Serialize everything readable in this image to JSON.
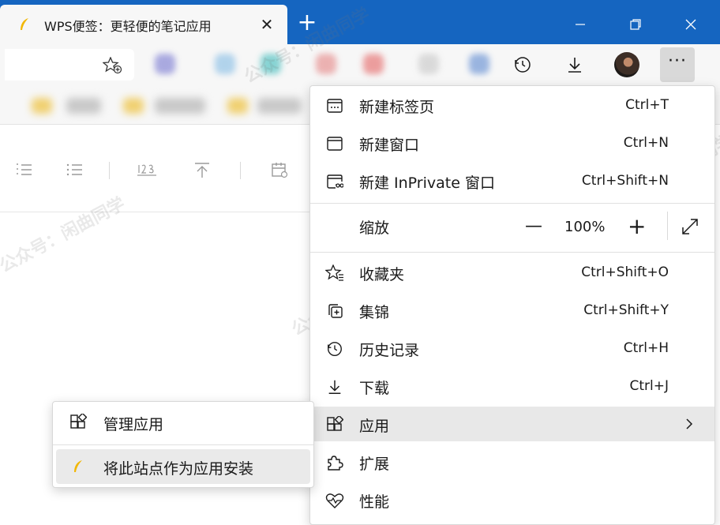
{
  "tab": {
    "title": "WPS便签：更轻便的笔记应用",
    "favicon": "feather-icon"
  },
  "window_controls": [
    "minimize-icon",
    "restore-icon",
    "close-icon"
  ],
  "toolbar": {
    "icons": [
      "favorites-add-icon",
      "history-icon",
      "download-icon",
      "profile-avatar",
      "more-icon"
    ],
    "more_label": "···"
  },
  "menu": {
    "items": [
      {
        "label": "新建标签页",
        "shortcut": "Ctrl+T",
        "icon": "new-tab-icon"
      },
      {
        "label": "新建窗口",
        "shortcut": "Ctrl+N",
        "icon": "new-window-icon"
      },
      {
        "label": "新建 InPrivate 窗口",
        "shortcut": "Ctrl+Shift+N",
        "icon": "inprivate-icon"
      },
      {
        "label": "收藏夹",
        "shortcut": "Ctrl+Shift+O",
        "icon": "favorites-icon"
      },
      {
        "label": "集锦",
        "shortcut": "Ctrl+Shift+Y",
        "icon": "collections-icon"
      },
      {
        "label": "历史记录",
        "shortcut": "Ctrl+H",
        "icon": "history-icon"
      },
      {
        "label": "下载",
        "shortcut": "Ctrl+J",
        "icon": "download-icon"
      },
      {
        "label": "应用",
        "shortcut": "",
        "icon": "apps-icon"
      },
      {
        "label": "扩展",
        "shortcut": "",
        "icon": "extensions-icon"
      },
      {
        "label": "性能",
        "shortcut": "",
        "icon": "performance-icon"
      }
    ],
    "zoom": {
      "label": "缩放",
      "minus": "—",
      "value": "100%",
      "plus": "+"
    }
  },
  "submenu": {
    "items": [
      {
        "label": "管理应用",
        "icon": "apps-icon"
      },
      {
        "label": "将此站点作为应用安装",
        "icon": "feather-icon"
      }
    ]
  },
  "watermark": {
    "text": "公众号：闲曲同学"
  },
  "colors": {
    "titlebar": "#1565c0",
    "toolbar": "#f7f7f7",
    "highlight": "#e8e8e8",
    "feather": "#f2b705"
  }
}
